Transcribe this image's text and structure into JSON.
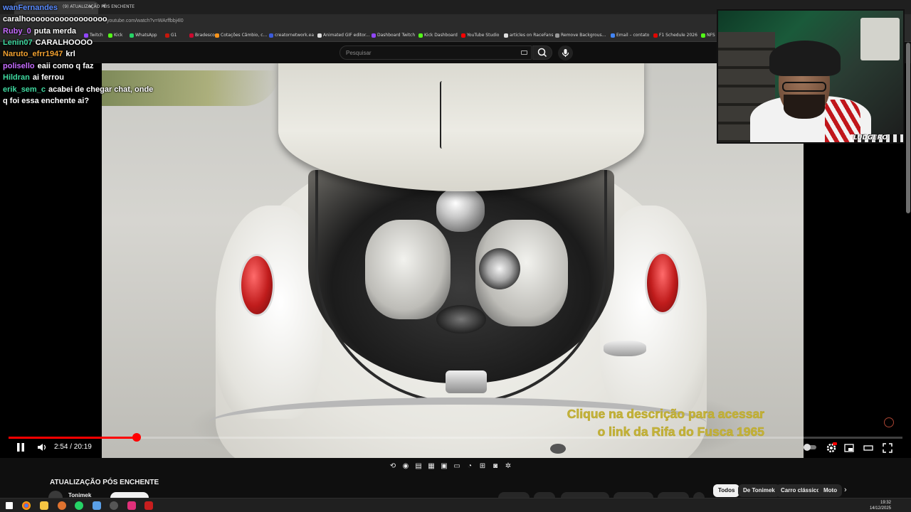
{
  "browser": {
    "tab_title": "(9) ATUALIZAÇÃO PÓS ENCHENTE",
    "url": "youtube.com/watch?v=WArffbbj4l0",
    "bookmarks": [
      {
        "label": "Twitch",
        "color": "#9146ff"
      },
      {
        "label": "Kick",
        "color": "#53fc18"
      },
      {
        "label": "WhatsApp",
        "color": "#25d366"
      },
      {
        "label": "G1",
        "color": "#c4170c"
      },
      {
        "label": "Bradesco",
        "color": "#cc092f"
      },
      {
        "label": "Cotações Câmbio, c...",
        "color": "#f7931a"
      },
      {
        "label": "creatornetwork.ea",
        "color": "#3b5bdb"
      },
      {
        "label": "Animated GIF editor...",
        "color": "#e0e0e0"
      },
      {
        "label": "Dashboard Twitch",
        "color": "#9146ff"
      },
      {
        "label": "Kick Dashboard",
        "color": "#53fc18"
      },
      {
        "label": "YouTube Studio",
        "color": "#ff0000"
      },
      {
        "label": "articles on RaceFans",
        "color": "#e0e0e0"
      },
      {
        "label": "Remove Backgrous...",
        "color": "#999999"
      },
      {
        "label": "Email – contato",
        "color": "#4285f4"
      },
      {
        "label": "F1 Schedule 2026",
        "color": "#e10600"
      },
      {
        "label": "NFS",
        "color": "#53fc18"
      }
    ]
  },
  "search": {
    "placeholder": "Pesquisar"
  },
  "chat": [
    {
      "user": "wanFernandes",
      "text": "",
      "color": "#5b8cff"
    },
    {
      "user": "",
      "text": "caralhooooooooooooooooo",
      "color": "#ffffff"
    },
    {
      "user": "Ruby_0",
      "text": "puta merda",
      "color": "#c66cff"
    },
    {
      "user": "Lenin07",
      "text": "CARALHOOOO",
      "color": "#3fd9a0"
    },
    {
      "user": "Naruto_efrr1947",
      "text": "krl",
      "color": "#f0a030"
    },
    {
      "user": "polisello",
      "text": "eaii como q faz",
      "color": "#c66cff"
    },
    {
      "user": "Hildran",
      "text": "ai ferrou",
      "color": "#3fd9a0"
    },
    {
      "user": "erik_sem_c",
      "text": "acabei de chegar chat, onde",
      "color": "#3fd9a0"
    },
    {
      "user": "",
      "text": "q foi essa enchente ai?",
      "color": "#ffffff"
    }
  ],
  "webcam": {
    "overlay_label": "LUDGERO"
  },
  "video": {
    "caption_line1": "Clique na descrição para acessar",
    "caption_line2": "o link da Rifa do Fusca 1965",
    "time_display": "2:54 / 20:19",
    "progress": 0.143
  },
  "below": {
    "title": "ATUALIZAÇÃO PÓS ENCHENTE",
    "channel": "Tonimek",
    "chips": [
      {
        "label": "Todos",
        "active": true
      },
      {
        "label": "De Tonimek",
        "active": false
      },
      {
        "label": "Carro clássico",
        "active": false
      },
      {
        "label": "Moto",
        "active": false
      }
    ]
  },
  "clock": {
    "time": "19:32",
    "date": "14/12/2025"
  }
}
